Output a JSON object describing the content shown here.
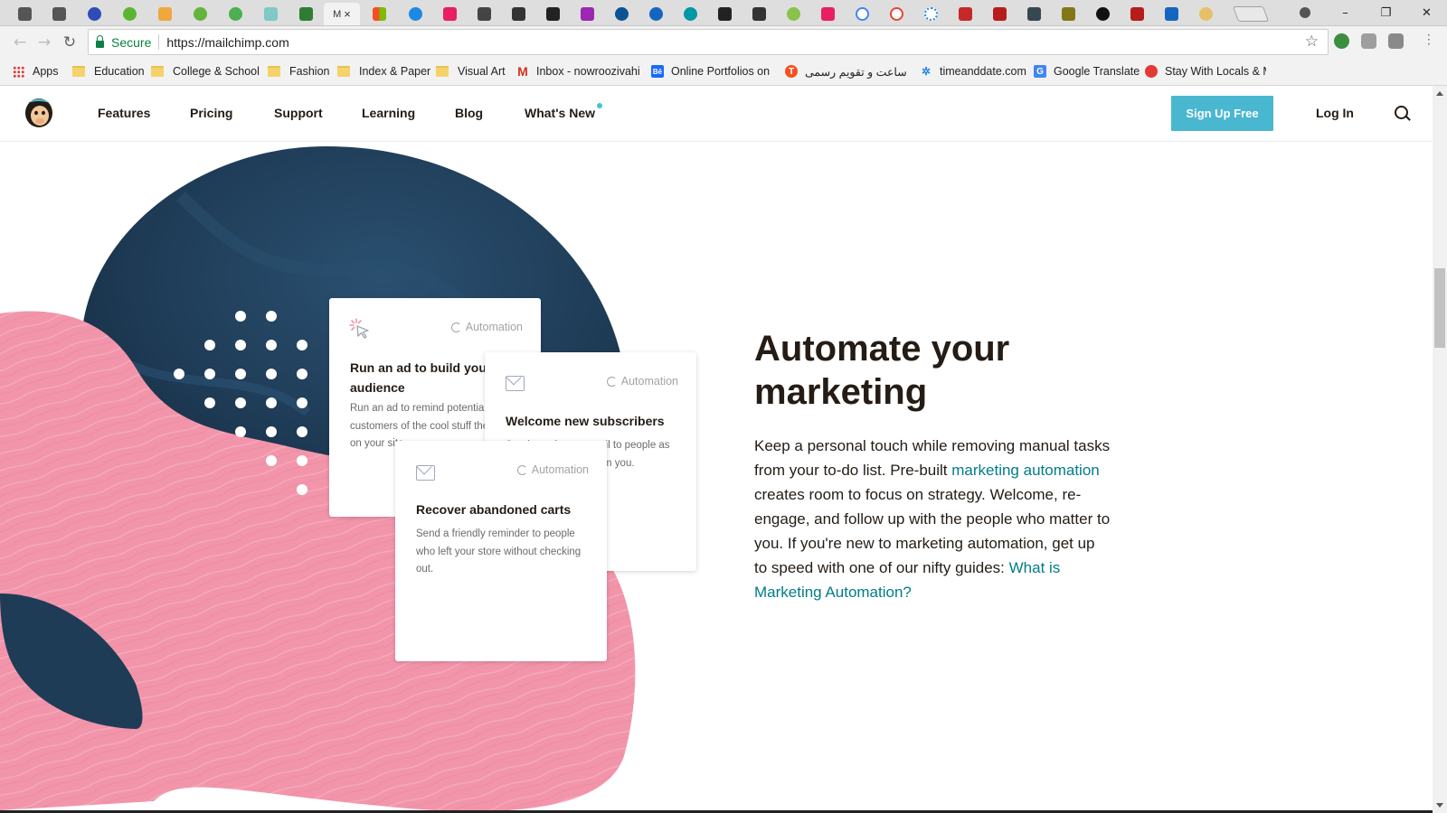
{
  "browser": {
    "active_tab_label": "M",
    "active_tab_close": "×",
    "window_controls": {
      "minimize": "–",
      "maximize": "❐",
      "close": "✕"
    },
    "address": {
      "secure_label": "Secure",
      "url": "https://mailchimp.com"
    },
    "bookmarks": [
      {
        "label": "Apps",
        "icon": "apps-grid-icon"
      },
      {
        "label": "Education",
        "icon": "folder-icon"
      },
      {
        "label": "College & School",
        "icon": "folder-icon"
      },
      {
        "label": "Fashion",
        "icon": "folder-icon"
      },
      {
        "label": "Index & Paper",
        "icon": "folder-icon"
      },
      {
        "label": "Visual Art",
        "icon": "folder-icon"
      },
      {
        "label": "Inbox - nowroozivahi",
        "icon": "gmail-icon"
      },
      {
        "label": "Online Portfolios on B",
        "icon": "behance-icon"
      },
      {
        "label": "ساعت و تقویم رسمی",
        "icon": "t-icon"
      },
      {
        "label": "timeanddate.com",
        "icon": "timeanddate-icon"
      },
      {
        "label": "Google Translate",
        "icon": "google-translate-icon"
      },
      {
        "label": "Stay With Locals & M",
        "icon": "couchsurfing-icon"
      }
    ]
  },
  "site": {
    "nav": {
      "features": "Features",
      "pricing": "Pricing",
      "support": "Support",
      "learning": "Learning",
      "blog": "Blog",
      "whats_new": "What's New",
      "signup": "Sign Up Free",
      "login": "Log In"
    },
    "cards": [
      {
        "badge": "Automation",
        "title": "Run an ad to build your audience",
        "desc": "Run an ad to remind potential customers of the cool stuff they saw on your site."
      },
      {
        "badge": "Automation",
        "title": "Welcome new subscribers",
        "desc": "Send a welcome email to people as soon as they hear from you."
      },
      {
        "badge": "Automation",
        "title": "Recover abandoned carts",
        "desc": "Send a friendly reminder to people who left your store without checking out."
      }
    ],
    "section": {
      "heading": "Automate your marketing",
      "body_1": "Keep a personal touch while removing manual tasks from your to-do list. Pre-built ",
      "link_1": "marketing automation",
      "body_2": " creates room to focus on strategy. Welcome, re-engage, and follow up with the people who matter to you. If you're new to marketing automation, get up to speed with one of our nifty guides: ",
      "link_2": "What is Marketing Automation?"
    },
    "colors": {
      "accent": "#4ab7d1",
      "link": "#007c89",
      "navy": "#1f3c57",
      "pink": "#f295ab"
    }
  }
}
